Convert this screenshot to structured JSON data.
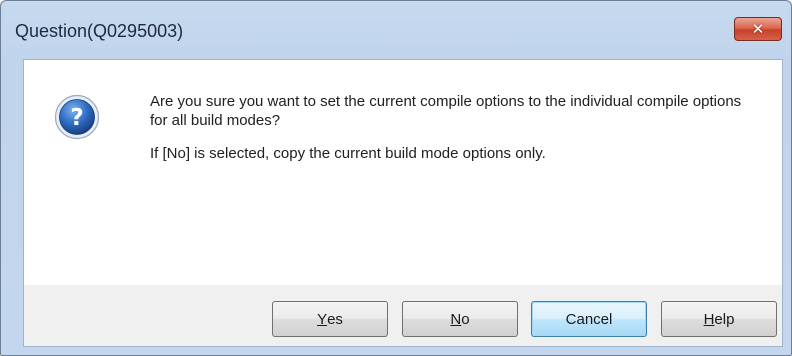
{
  "dialog": {
    "title": "Question(Q0295003)",
    "close_label": "✕",
    "icon": "question-icon",
    "message_line1": "Are you sure you want to set the current compile options to the individual compile options for all build modes?",
    "message_line2": "If [No] is selected, copy the current build mode options only."
  },
  "buttons": {
    "yes": {
      "mnemonic": "Y",
      "rest": "es"
    },
    "no": {
      "mnemonic": "N",
      "rest": "o"
    },
    "cancel": {
      "label": "Cancel"
    },
    "help": {
      "mnemonic": "H",
      "rest": "elp"
    }
  },
  "colors": {
    "title_bar": "#c3d6ed",
    "close_button": "#c8422a",
    "icon_blue": "#1f5fb3",
    "default_button_border": "#3c7fb1"
  }
}
